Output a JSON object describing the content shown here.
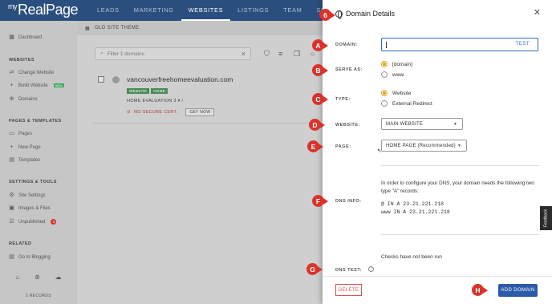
{
  "brand": {
    "my": "my",
    "name": "RealPage"
  },
  "nav": {
    "items": [
      {
        "label": "LEADS"
      },
      {
        "label": "MARKETING"
      },
      {
        "label": "WEBSITES",
        "active": true
      },
      {
        "label": "LISTINGS"
      },
      {
        "label": "TEAM"
      },
      {
        "label": "SOLUTIONS"
      },
      {
        "label": "S"
      }
    ]
  },
  "sidebar": {
    "dashboard": "Dashboard",
    "websites_header": "WEBSITES",
    "change_website": "Change Website",
    "build_website": "Build Website",
    "build_badge": "NEW",
    "domains": "Domains",
    "pages_header": "PAGES & TEMPLATES",
    "pages": "Pages",
    "new_page": "New Page",
    "templates": "Templates",
    "settings_header": "SETTINGS & TOOLS",
    "site_settings": "Site Settings",
    "images_files": "Images & Files",
    "unpublished": "Unpublished",
    "unpublished_count": "3",
    "related_header": "RELATED",
    "go_to_blogging": "Go to Blogging",
    "records": "1 RECORDS"
  },
  "main": {
    "theme_label": "OLD SITE THEME",
    "filter_placeholder": "Filter 1 domains",
    "row": {
      "domain": "vancouverfreehomeevaluation.com",
      "tags": [
        "WEBSITE",
        "HOME"
      ],
      "page": "HOME EVALUATION 3",
      "page_suffix": "/",
      "cert": "NO SECURE CERT.",
      "get_now": "GET NOW"
    }
  },
  "modal": {
    "title": "Domain Details",
    "domain_label": "DOMAIN:",
    "domain_value": "",
    "test_label": "TEST",
    "serve_as_label": "SERVE AS:",
    "serve_as_options": [
      "[domain]",
      "www."
    ],
    "serve_as_selected": 0,
    "type_label": "TYPE:",
    "type_options": [
      "Website",
      "External Redirect"
    ],
    "type_selected": 0,
    "website_label": "WEBSITE:",
    "website_value": "MAIN WEBSITE",
    "page_label": "PAGE:",
    "page_value": "HOME PAGE (Recommended)",
    "dns_info_label": "DNS INFO:",
    "dns_info_text": "In order to configure your DNS, your domain needs the following two type \"A\" records:",
    "dns_records": [
      "@ IN A 23.21.221.218",
      "www IN A 23.21.221.218"
    ],
    "checks_text": "Checks have not been run",
    "dns_test_label": "DNS TEST:",
    "delete_label": "DELETE",
    "add_domain_label": "ADD DOMAIN"
  },
  "feedback": "Feedback",
  "callouts": [
    "6",
    "A",
    "B",
    "C",
    "D",
    "E",
    "F",
    "G",
    "H"
  ],
  "colors": {
    "nav_bg": "#2a4f7f",
    "accent": "#2a5aa8",
    "radio_on": "#e0a21e",
    "danger": "#d9342b",
    "tag_green": "#4a8a57"
  }
}
